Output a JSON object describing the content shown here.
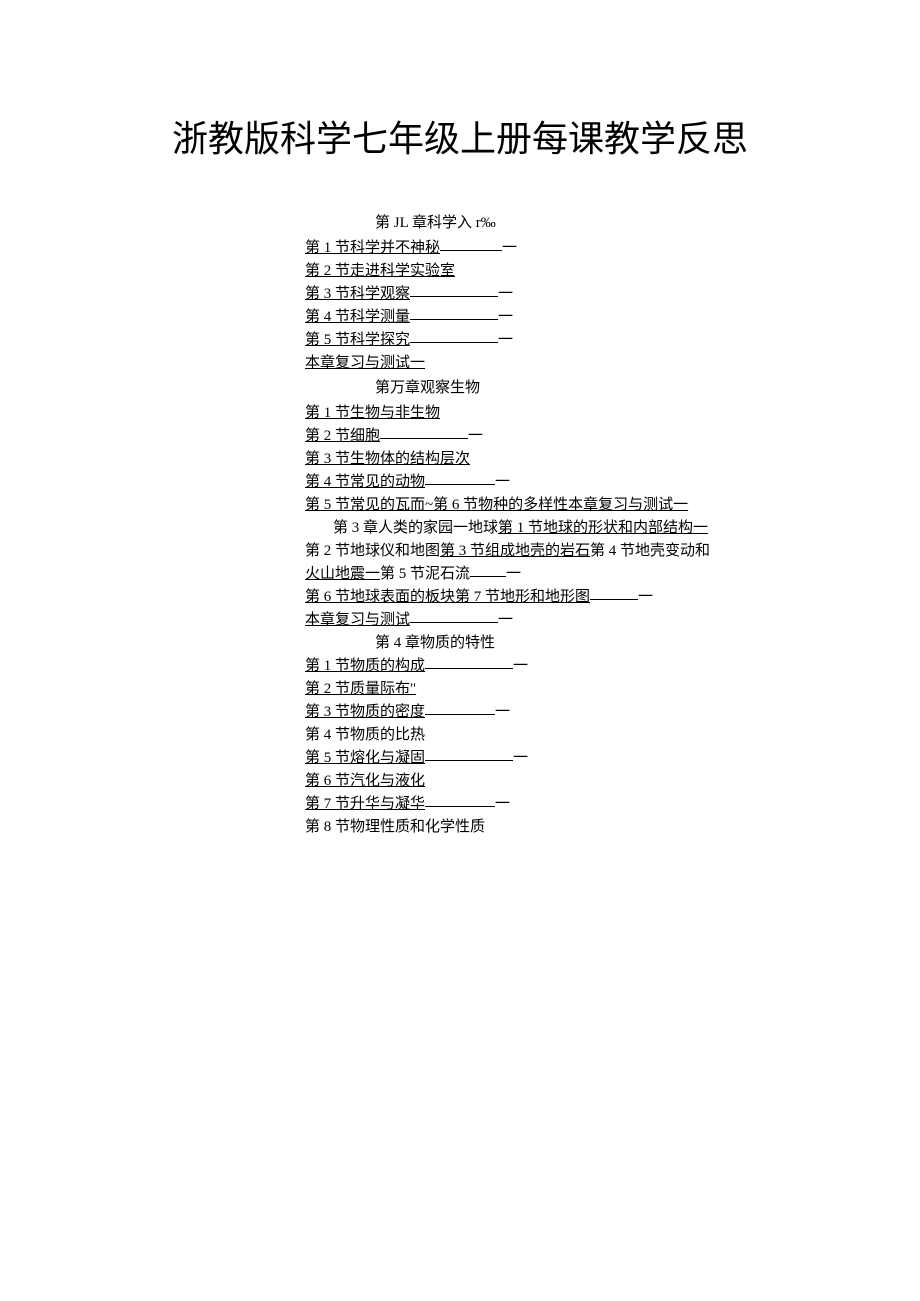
{
  "title": "浙教版科学七年级上册每课教学反思",
  "ch1": {
    "header": "第 JL 章科学入 r‰",
    "items": [
      "第 1 节科学并不神秘",
      "第 2 节走进科学实验室",
      "第 3 节科学观察",
      "第 4 节科学测量",
      "第 5 节科学探究",
      "本章复习与测试一"
    ]
  },
  "ch2": {
    "header": "第万章观察生物",
    "items": [
      "第 1 节生物与非生物",
      "第 2 节细胞",
      "第 3 节生物体的结构层次",
      "第 4 节常见的动物",
      "第 5 节常见的瓦而~第 6 节物种的多样性本章复习与测试一"
    ]
  },
  "ch3": {
    "line1_a": "第 3 章人类的家园一地球",
    "line1_b": "第 1 节地球的形状和内部结构一",
    "line2_a": "第 2 节地球仪和地图",
    "line2_b": "第 3 节组成地壳的岩石",
    "line2_c": "第 4 节地壳变动和",
    "line3_a": "火山地震一",
    "line3_b": "第 5 节泥石流",
    "line4": "第 6 节地球表面的板块第 7 节地形和地形图",
    "line5": "本章复习与测试"
  },
  "ch4": {
    "header": "第 4 章物质的特性",
    "items": [
      "第 1 节物质的构成",
      "第 2 节质量际布\"",
      "第 3 节物质的密度",
      "第 4 节物质的比热",
      "第 5 节熔化与凝固",
      "第 6 节汽化与液化",
      "第 7 节升华与凝华",
      "第 8 节物理性质和化学性质"
    ]
  },
  "dash": "一"
}
